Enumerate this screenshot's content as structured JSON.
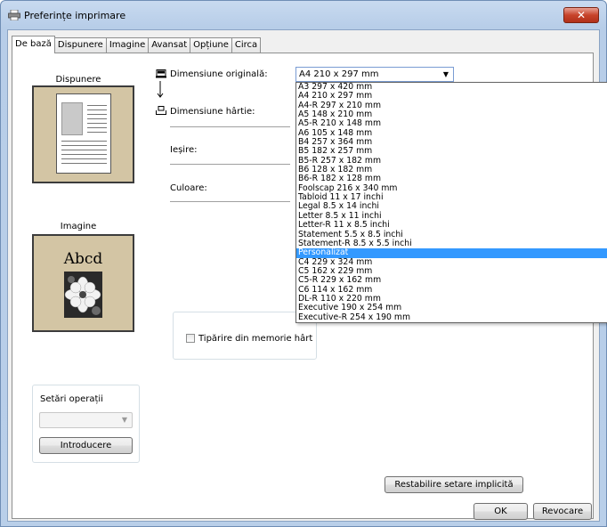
{
  "window": {
    "title": "Preferințe imprimare",
    "close_label": "✕"
  },
  "tabs": [
    {
      "label": "De bază",
      "active": true
    },
    {
      "label": "Dispunere",
      "active": false
    },
    {
      "label": "Imagine",
      "active": false
    },
    {
      "label": "Avansat",
      "active": false
    },
    {
      "label": "Opțiune",
      "active": false
    },
    {
      "label": "Circa",
      "active": false
    }
  ],
  "left_panel": {
    "layout_label": "Dispunere",
    "image_label": "Imagine",
    "image_text": "Abcd",
    "settings_group": {
      "title": "Setări operații",
      "select_value": "",
      "button_label": "Introducere"
    }
  },
  "fields": {
    "original_size_label": "Dimensiune originală:",
    "paper_size_label": "Dimensiune hârtie:",
    "output_label": "Ieșire:",
    "color_label": "Culoare:",
    "original_size_value": "A4 210 x 297 mm",
    "memory_print_label": "Tipărire din memorie hârt"
  },
  "dropdown": {
    "selected_index": 22,
    "options": [
      "A3 297 x 420 mm",
      "A4 210 x 297 mm",
      "A4-R 297 x 210 mm",
      "A5 148 x 210 mm",
      "A5-R 210 x 148 mm",
      "A6 105 x 148 mm",
      "B4 257 x 364 mm",
      "B5 182 x 257 mm",
      "B5-R 257 x 182 mm",
      "B6 128 x 182 mm",
      "B6-R 182 x 128 mm",
      "Foolscap 216 x 340 mm",
      "Tabloid 11 x 17 inchi",
      "Legal 8.5 x 14 inchi",
      "Letter 8.5 x 11 inchi",
      "Letter-R 11 x 8.5 inchi",
      "Statement 5.5 x 8.5 inchi",
      "Statement-R 8.5 x 5.5 inchi",
      "Personalizat",
      "C4 229 x 324 mm",
      "C5 162 x 229 mm",
      "C5-R 229 x 162 mm",
      "C6 114 x 162 mm",
      "DL-R 110 x 220 mm",
      "Executive 190 x 254 mm",
      "Executive-R 254 x 190 mm"
    ]
  },
  "buttons": {
    "restore_defaults": "Restabilire setare implicită",
    "ok": "OK",
    "cancel": "Revocare"
  },
  "colors": {
    "title_gradient": "#b7cde8",
    "selection": "#3399ff",
    "preview_bg": "#d3c5a4"
  }
}
